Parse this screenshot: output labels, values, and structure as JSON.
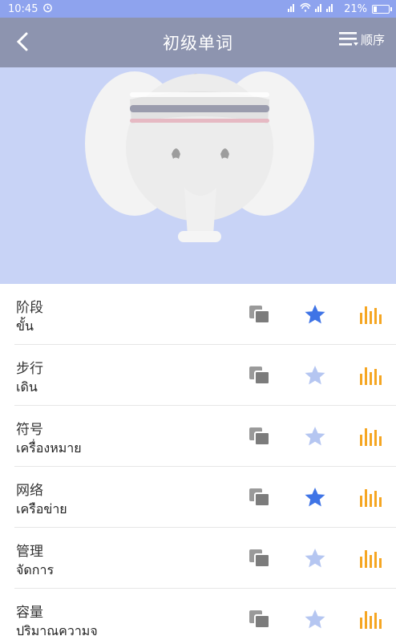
{
  "status_bar": {
    "time": "10:45",
    "battery_percent": "21%",
    "battery_level": 0.21
  },
  "header": {
    "title": "初级单词",
    "order_label": "顺序"
  },
  "colors": {
    "accent_blue": "#3f74e6",
    "light_star": "#b5c6f1",
    "orange": "#f5a623",
    "header_bg": "#8d94af",
    "banner_bg": "#c8d3f6"
  },
  "words": [
    {
      "word": "阶段",
      "translation": "ขั้น",
      "starred": true
    },
    {
      "word": "步行",
      "translation": "เดิน",
      "starred": false
    },
    {
      "word": "符号",
      "translation": "เครื่องหมาย",
      "starred": false
    },
    {
      "word": "网络",
      "translation": "เครือข่าย",
      "starred": true
    },
    {
      "word": "管理",
      "translation": "จัดการ",
      "starred": false
    },
    {
      "word": "容量",
      "translation": "ปริมาณความจ",
      "starred": false
    }
  ]
}
